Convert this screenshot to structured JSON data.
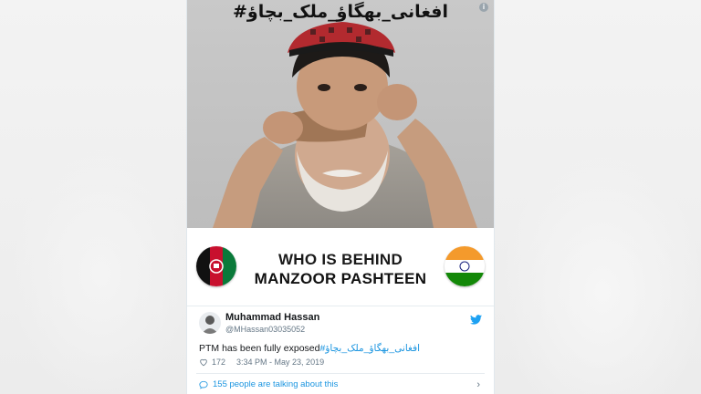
{
  "image": {
    "hashtag_banner": "#افغانی_بھگاؤ_ملک_بچاؤ",
    "info_icon": "info-icon"
  },
  "banner": {
    "line1": "WHO IS BEHIND",
    "line2": "MANZOOR PASHTEEN",
    "left_flag": "afghanistan-flag-icon",
    "right_flag": "india-flag-icon"
  },
  "tweet": {
    "author_name": "Muhammad Hassan",
    "author_handle": "@MHassan03035052",
    "text": "PTM has been fully exposed",
    "hashtag": "#افغانی_بھگاؤ_ملک_بچاؤ",
    "likes": "172",
    "timestamp": "3:34 PM - May 23, 2019",
    "talking_text": "155 people are talking about this"
  },
  "colors": {
    "twitter_blue": "#1b95e0",
    "secondary_text": "#657786",
    "primary_text": "#14171a"
  }
}
